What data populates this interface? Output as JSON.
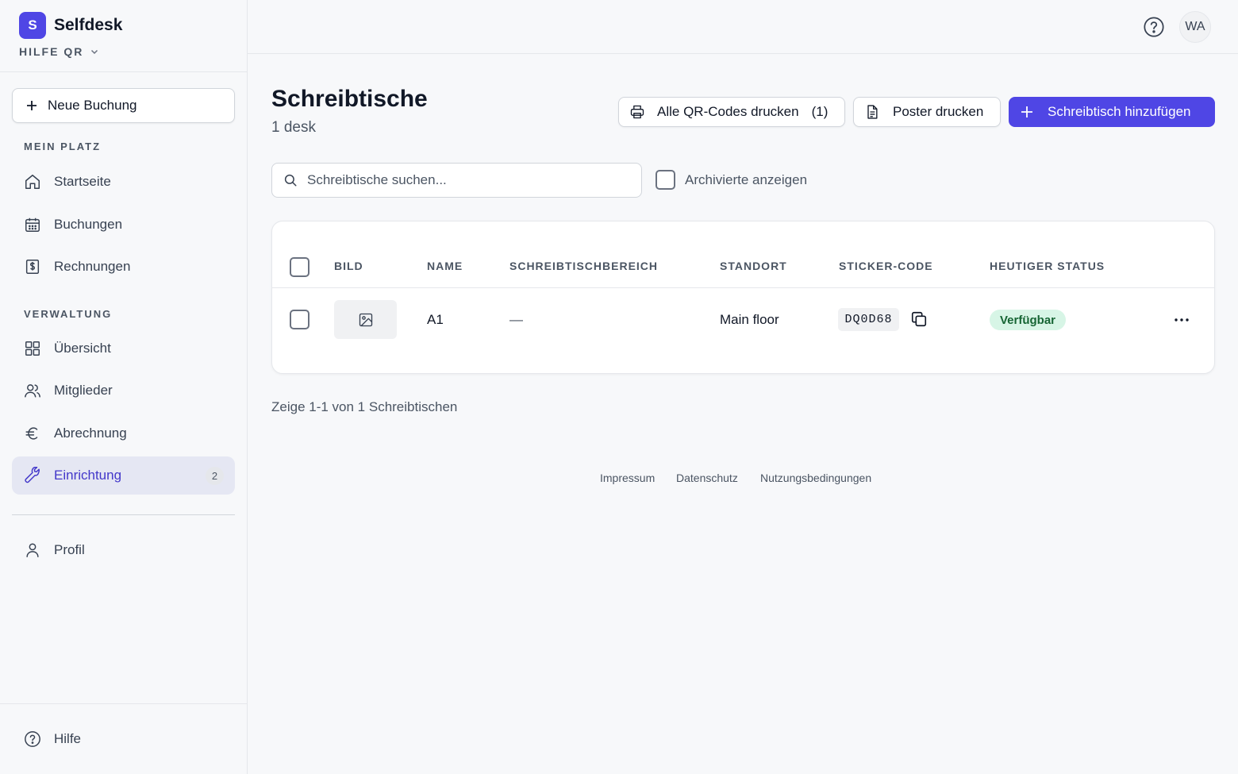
{
  "brand": {
    "logo_letter": "S",
    "name": "Selfdesk",
    "accent": "#4f46e5"
  },
  "workspace": {
    "label": "HILFE QR"
  },
  "sidebar": {
    "new_booking": "Neue Buchung",
    "section_my_space": "MEIN PLATZ",
    "section_admin": "VERWALTUNG",
    "items": {
      "home": "Startseite",
      "bookings": "Buchungen",
      "invoices": "Rechnungen",
      "overview": "Übersicht",
      "members": "Mitglieder",
      "billing": "Abrechnung",
      "setup": "Einrichtung",
      "setup_badge": "2",
      "profile": "Profil",
      "help": "Hilfe"
    }
  },
  "topbar": {
    "avatar_initials": "WA"
  },
  "page": {
    "title": "Schreibtische",
    "subtitle": "1 desk",
    "actions": {
      "print_all": "Alle QR-Codes drucken",
      "print_all_count": "(1)",
      "print_poster": "Poster drucken",
      "add_desk": "Schreibtisch hinzufügen"
    },
    "search_placeholder": "Schreibtische suchen...",
    "show_archived": "Archivierte anzeigen"
  },
  "table": {
    "columns": [
      "BILD",
      "NAME",
      "SCHREIBTISCHBEREICH",
      "STANDORT",
      "STICKER-CODE",
      "HEUTIGER STATUS"
    ],
    "rows": [
      {
        "name": "A1",
        "area": "—",
        "location": "Main floor",
        "sticker_code": "DQ0D68",
        "status": "Verfügbar",
        "status_color": "#d7f5e6"
      }
    ]
  },
  "pagination": {
    "text": "Zeige 1-1 von 1 Schreibtischen"
  },
  "footer": {
    "imprint": "Impressum",
    "privacy": "Datenschutz",
    "terms": "Nutzungsbedingungen"
  }
}
